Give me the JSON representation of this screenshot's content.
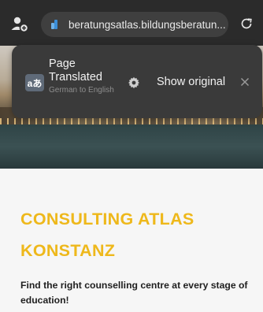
{
  "browser": {
    "url": "beratungsatlas.bildungsberatun..."
  },
  "translate_popup": {
    "title": "Page Translated",
    "subtitle": "German to English",
    "icon_glyph": "aあ",
    "show_original_label": "Show original"
  },
  "page": {
    "title": "CONSULTING ATLAS KONSTANZ",
    "subtitle": "Find the right counselling centre at every stage of education!"
  },
  "colors": {
    "toolbar": "#2b2b2b",
    "popup": "#3a3a3a",
    "title_accent": "#eeb81b",
    "page_background": "#f6f6f6"
  },
  "icons": [
    "incognito-tab-switcher-icon",
    "site-favicon",
    "reload-icon",
    "translate-icon",
    "gear-icon",
    "close-icon"
  ]
}
